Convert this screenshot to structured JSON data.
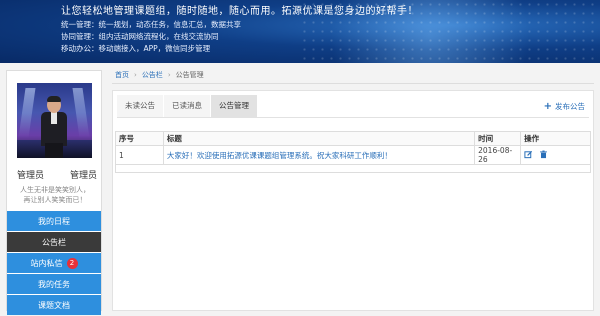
{
  "banner": {
    "slogan": "让您轻松地管理课题组，随时随地，随心而用。拓源优课是您身边的好帮手！",
    "lines": [
      "统一管理：统一规划，动态任务，信息汇总，数据共享",
      "协同管理：组内活动网络流程化，在线交流协同",
      "移动办公：移动端接入，APP，微信同步管理"
    ]
  },
  "user": {
    "role_left": "管理员",
    "role_right": "管理员",
    "motto_line1": "人生无非是笑笑别人，",
    "motto_line2": "再让别人笑笑而已！"
  },
  "menu": [
    {
      "label": "我的日程",
      "active": false
    },
    {
      "label": "公告栏",
      "active": true
    },
    {
      "label": "站内私信",
      "active": false,
      "badge": "2"
    },
    {
      "label": "我的任务",
      "active": false
    },
    {
      "label": "课题文档",
      "active": false
    }
  ],
  "breadcrumb": {
    "home": "首页",
    "middle": "公告栏",
    "current": "公告管理"
  },
  "tabs": [
    {
      "label": "未读公告",
      "active": false
    },
    {
      "label": "已读消息",
      "active": false
    },
    {
      "label": "公告管理",
      "active": true
    }
  ],
  "publish_label": "发布公告",
  "table": {
    "headers": [
      "序号",
      "标题",
      "时间",
      "操作"
    ],
    "rows": [
      {
        "no": "1",
        "title": "大家好！欢迎使用拓源优课课题组管理系统。祝大家科研工作顺利！",
        "date": "2016-08-26"
      }
    ]
  },
  "colors": {
    "menu_blue": "#2e8fde",
    "menu_active": "#3a3a3a",
    "link_blue": "#2a6fb8",
    "badge_red": "#e8313a"
  }
}
